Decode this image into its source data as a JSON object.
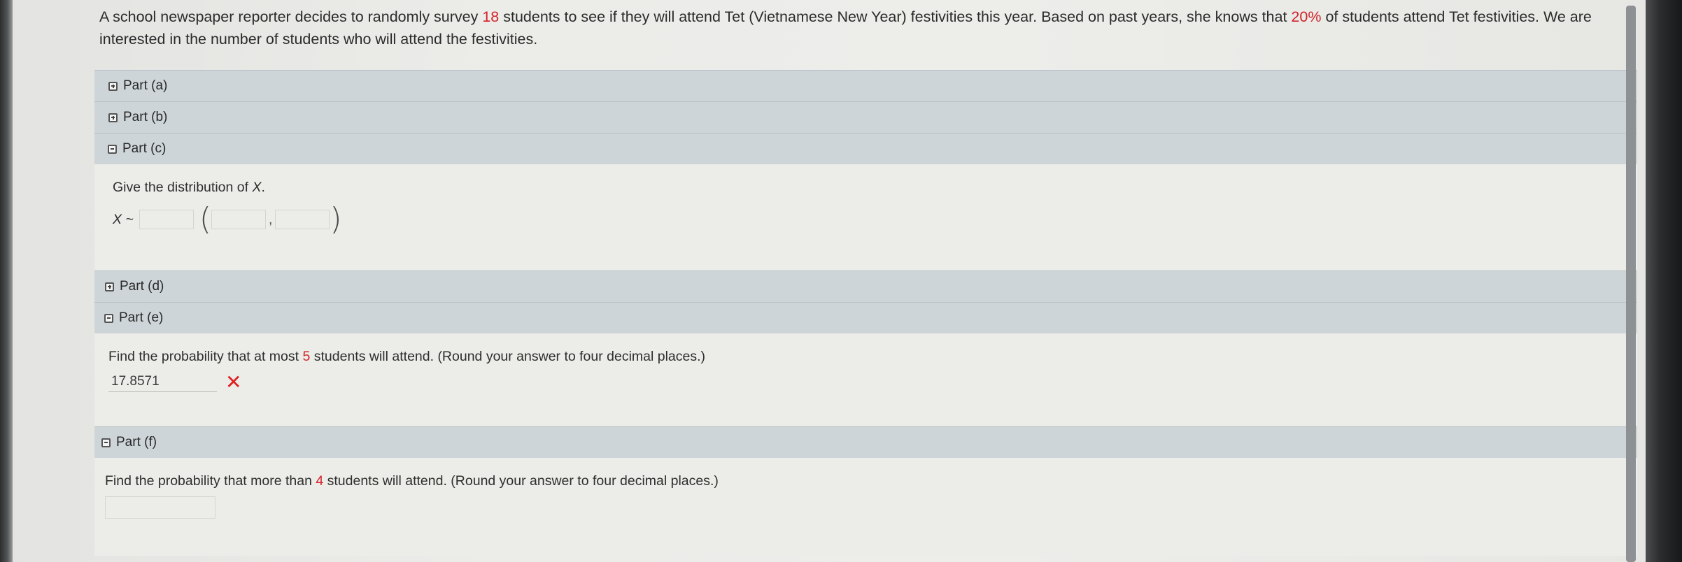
{
  "intro": {
    "part1": "A school newspaper reporter decides to randomly survey ",
    "n": "18",
    "part2": " students to see if they will attend Tet (Vietnamese New Year) festivities this year. Based on past years, she knows that ",
    "p": "20%",
    "part3": " of students attend Tet festivities. We are interested in the number of students who will attend the festivities."
  },
  "parts": {
    "a": {
      "label": "Part (a)",
      "state": "collapsed"
    },
    "b": {
      "label": "Part (b)",
      "state": "collapsed"
    },
    "c": {
      "label": "Part (c)",
      "state": "expanded",
      "question_prefix": "Give the distribution of ",
      "question_var": "X",
      "question_suffix": ".",
      "dist_prefix": "X ~",
      "dist_name_value": "",
      "param1_value": "",
      "param_sep": ",",
      "param2_value": ""
    },
    "d": {
      "label": "Part (d)",
      "state": "collapsed"
    },
    "e": {
      "label": "Part (e)",
      "state": "expanded",
      "question_part1": "Find the probability that at most ",
      "question_num": "5",
      "question_part2": " students will attend. (Round your answer to four decimal places.)",
      "answer_value": "17.8571",
      "answer_status": "incorrect",
      "answer_mark": "✕"
    },
    "f": {
      "label": "Part (f)",
      "state": "expanded",
      "question_part1": "Find the probability that more than ",
      "question_num": "4",
      "question_part2": " students will attend. (Round your answer to four decimal places.)",
      "answer_value": ""
    }
  },
  "colors": {
    "highlight": "#d2232a",
    "incorrect_mark": "#e02020",
    "section_bar": "#cdd5d8",
    "panel_bg": "#ecece8"
  },
  "icons": {
    "collapsed": "plus-square-icon",
    "expanded": "minus-square-icon"
  }
}
